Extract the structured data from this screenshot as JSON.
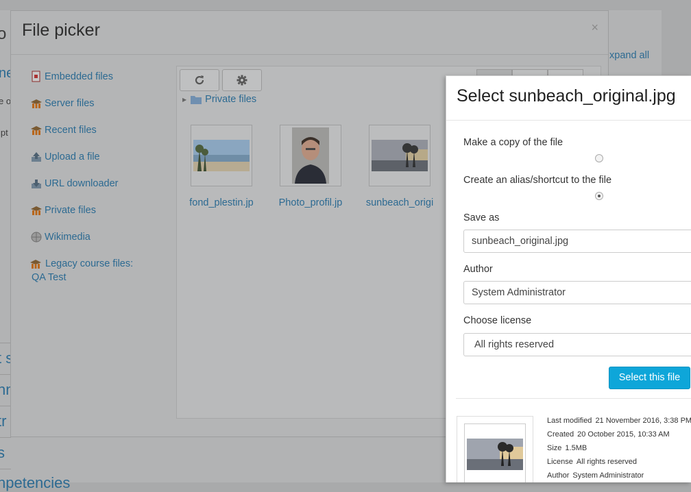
{
  "background": {
    "expand_all": "xpand all",
    "frag_1": "o",
    "frag_2": "ne",
    "frag_3": "e o",
    "frag_4": "ipt",
    "frag_5": "t s",
    "frag_6": "nn",
    "frag_7": "tr",
    "frag_8": "s",
    "frag_9": "npetencies"
  },
  "picker": {
    "title": "File picker",
    "close": "×",
    "repositories": [
      {
        "label": "Embedded files",
        "icon": "document-icon"
      },
      {
        "label": "Server files",
        "icon": "moodle-icon"
      },
      {
        "label": "Recent files",
        "icon": "moodle-icon"
      },
      {
        "label": "Upload a file",
        "icon": "upload-icon"
      },
      {
        "label": "URL downloader",
        "icon": "download-icon"
      },
      {
        "label": "Private files",
        "icon": "moodle-icon"
      },
      {
        "label": "Wikimedia",
        "icon": "globe-icon"
      },
      {
        "label": "Legacy course files: QA Test",
        "icon": "moodle-icon"
      }
    ],
    "breadcrumb": "Private files",
    "files": [
      {
        "name": "fond_plestin.jp",
        "kind": "landscape"
      },
      {
        "name": "Photo_profil.jp",
        "kind": "portrait"
      },
      {
        "name": "sunbeach_origi",
        "kind": "sunset"
      }
    ]
  },
  "select": {
    "title": "Select sunbeach_original.jpg",
    "copy_label": "Make a copy of the file",
    "alias_label": "Create an alias/shortcut to the file",
    "save_as_label": "Save as",
    "save_as_value": "sunbeach_original.jpg",
    "author_label": "Author",
    "author_value": "System Administrator",
    "license_label": "Choose license",
    "license_value": "All rights reserved",
    "button": "Select this file",
    "meta": {
      "last_modified_k": "Last modified",
      "last_modified_v": "21 November 2016, 3:38 PM",
      "created_k": "Created",
      "created_v": "20 October 2015, 10:33 AM",
      "size_k": "Size",
      "size_v": "1.5MB",
      "license_k": "License",
      "license_v": "All rights reserved",
      "author_k": "Author",
      "author_v": "System Administrator"
    }
  },
  "colors": {
    "link": "#2c6a92",
    "primary_button": "#0ea6d9"
  }
}
